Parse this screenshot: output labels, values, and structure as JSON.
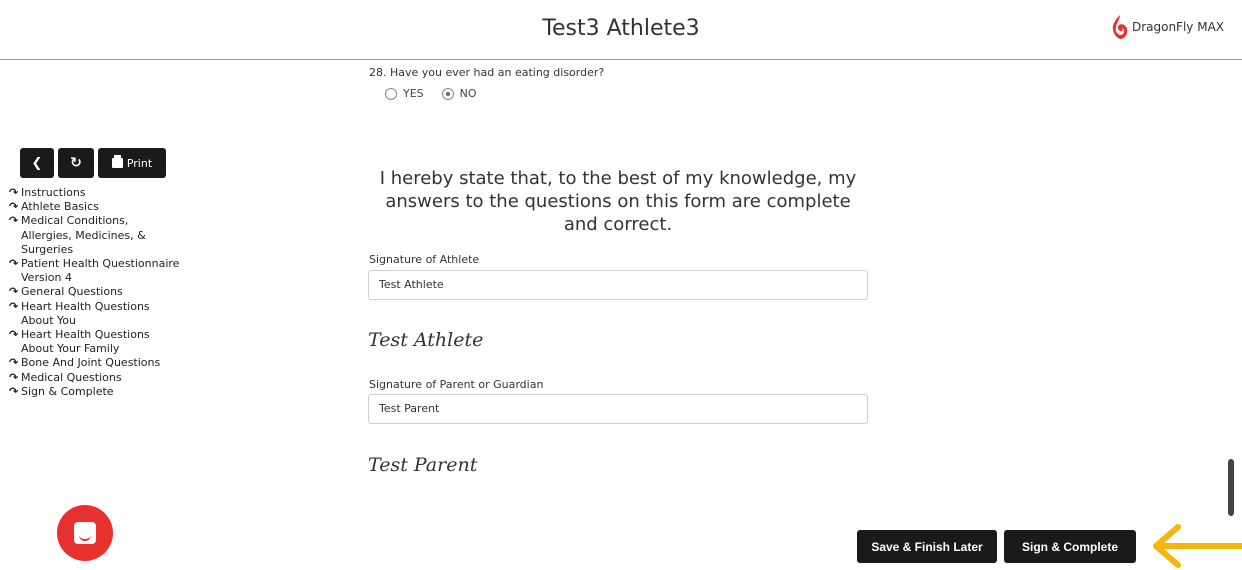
{
  "header": {
    "title": "Test3 Athlete3",
    "brand_name": "DragonFly MAX",
    "brand_color": "#e8312f"
  },
  "question": {
    "text": "28. Have you ever had an eating disorder?",
    "options": [
      {
        "label": "YES",
        "selected": false
      },
      {
        "label": "NO",
        "selected": true
      }
    ]
  },
  "toolbar": {
    "back_icon": "chevron-left-icon",
    "refresh_icon": "refresh-icon",
    "print_label": "Print"
  },
  "nav": {
    "icon": "external-link-icon",
    "items": [
      {
        "label": "Instructions"
      },
      {
        "label": "Athlete Basics"
      },
      {
        "label": "Medical Conditions,\nAllergies, Medicines, &\nSurgeries"
      },
      {
        "label": "Patient Health Questionnaire\nVersion 4"
      },
      {
        "label": "General Questions"
      },
      {
        "label": "Heart Health Questions\nAbout You"
      },
      {
        "label": "Heart Health Questions\nAbout Your Family"
      },
      {
        "label": "Bone And Joint Questions"
      },
      {
        "label": "Medical Questions"
      },
      {
        "label": "Sign & Complete"
      }
    ]
  },
  "statement": "I hereby state that, to the best of my knowledge, my answers to the questions on this form are complete and correct.",
  "athlete_signature": {
    "label": "Signature of Athlete",
    "value": "Test Athlete",
    "rendered": "Test Athlete"
  },
  "parent_signature": {
    "label": "Signature of Parent or Guardian",
    "value": "Test Parent",
    "rendered": "Test Parent"
  },
  "actions": {
    "save_later": "Save & Finish Later",
    "sign_complete": "Sign & Complete"
  },
  "colors": {
    "button_bg": "#1a1a1a",
    "chat_button": "#e8312f",
    "arrow": "#f5b50d"
  }
}
